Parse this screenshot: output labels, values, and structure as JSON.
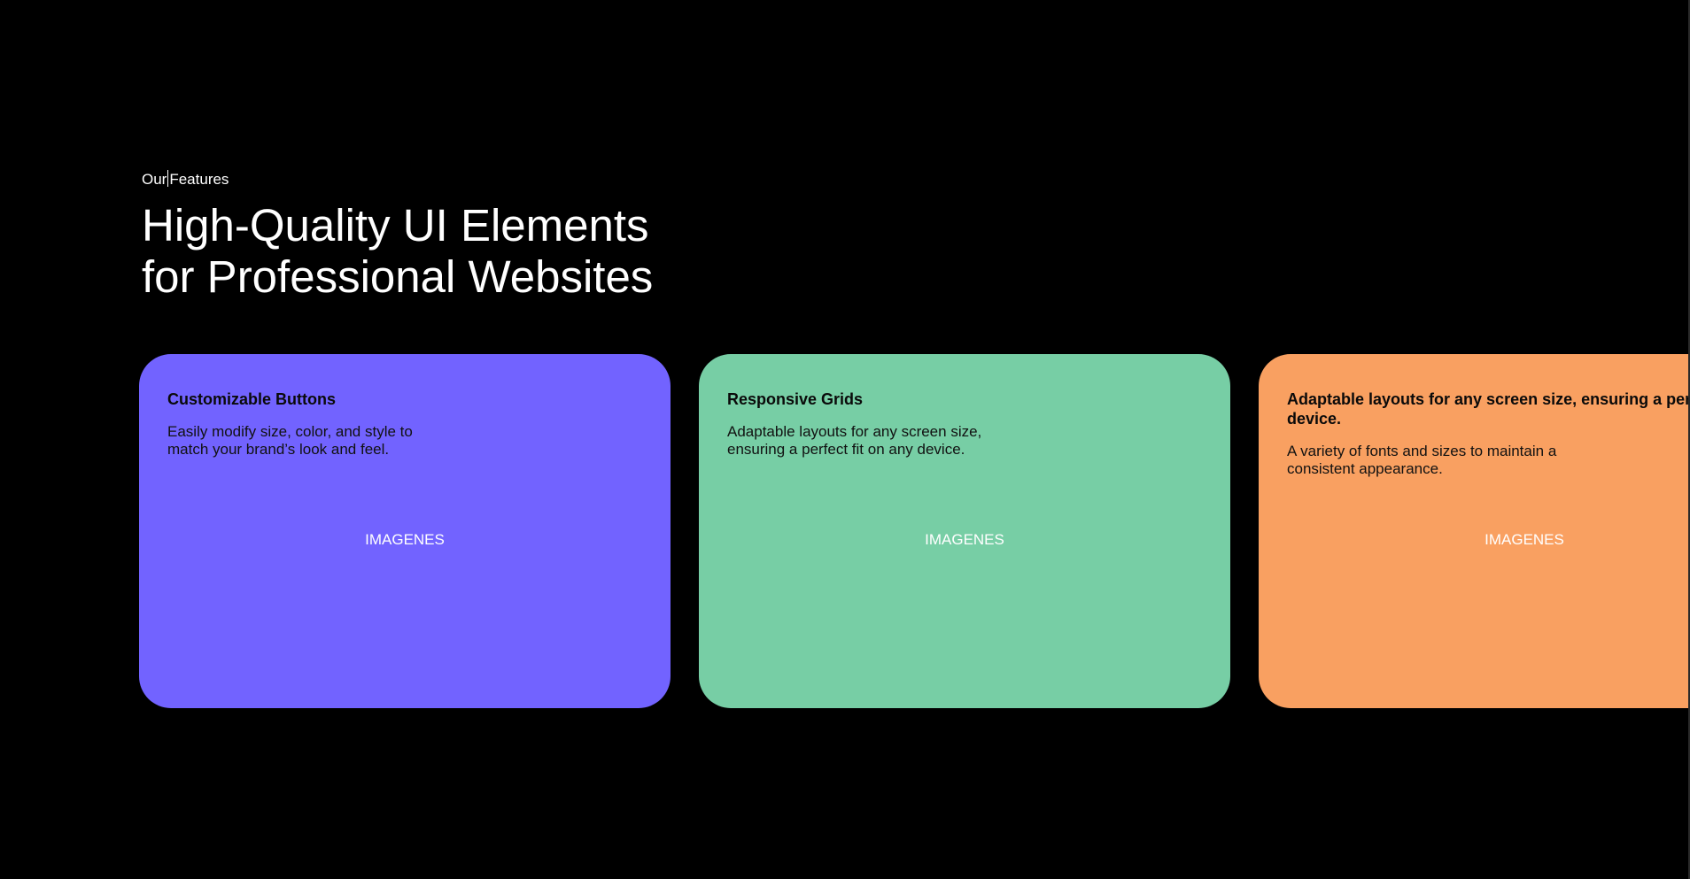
{
  "section": {
    "eyebrow_part1": "Our",
    "eyebrow_part2": "Features",
    "headline_line1": "High-Quality UI Elements",
    "headline_line2": "for Professional Websites"
  },
  "cards": [
    {
      "title": "Customizable Buttons",
      "text": "Easily modify size, color, and style to match your brand’s look and feel.",
      "image_label": "IMAGENES",
      "color": "#7263FF"
    },
    {
      "title": "Responsive Grids",
      "text": "Adaptable layouts for any screen size, ensuring a perfect fit on any device.",
      "image_label": "IMAGENES",
      "color": "#77CEA5"
    },
    {
      "title": "Adaptable layouts for any screen size, ensuring a perfect fit on any device.",
      "text": "A variety of fonts and sizes to maintain a consistent appearance.",
      "image_label": "IMAGENES",
      "color": "#F9A061"
    }
  ],
  "theme": {
    "background": "#000000",
    "text": "#FFFFFF"
  }
}
